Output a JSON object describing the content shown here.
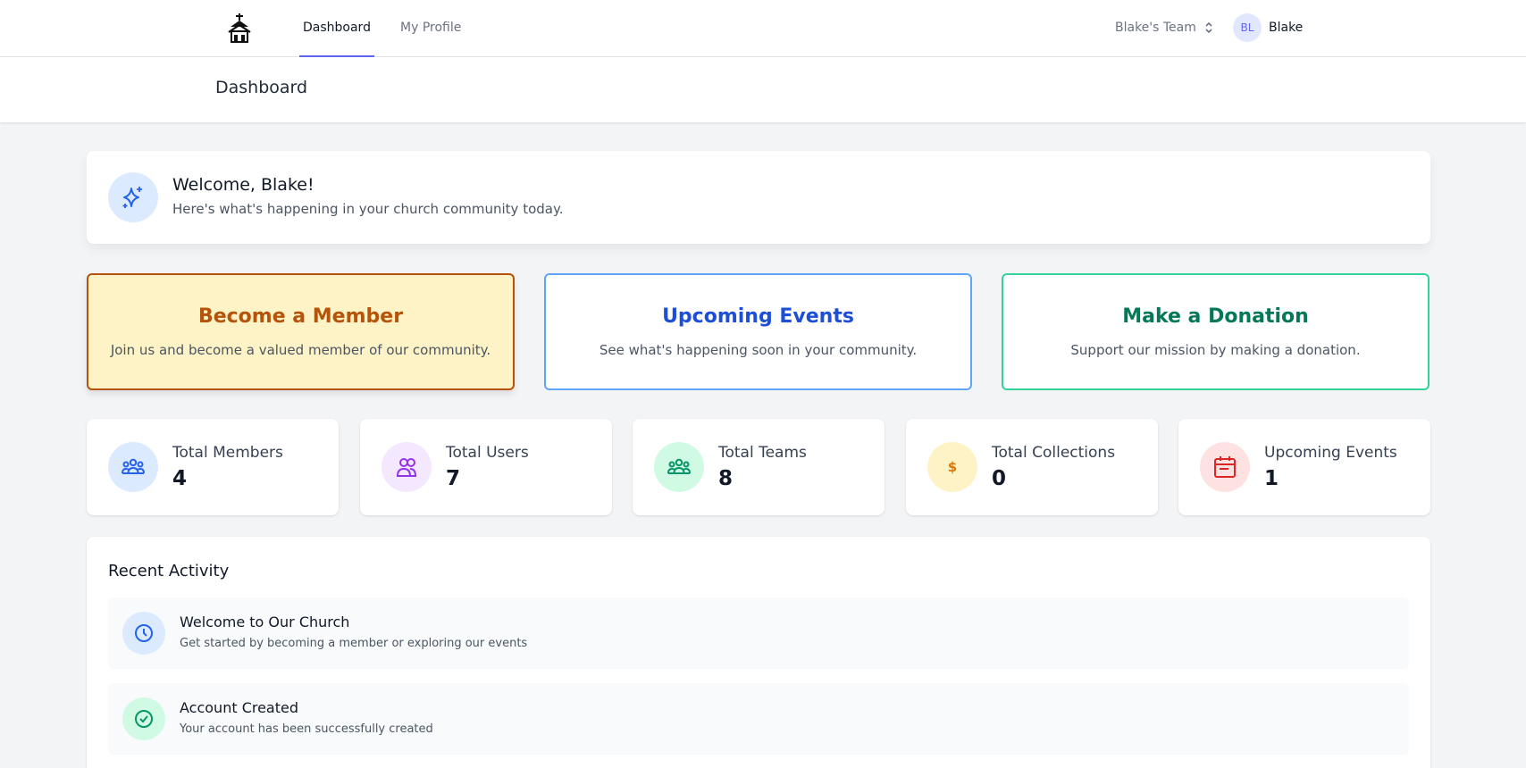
{
  "nav": {
    "links": [
      {
        "label": "Dashboard",
        "active": true
      },
      {
        "label": "My Profile",
        "active": false
      }
    ],
    "team_switcher": "Blake's Team",
    "user": {
      "initials": "BL",
      "name": "Blake"
    }
  },
  "header": {
    "title": "Dashboard"
  },
  "welcome": {
    "title": "Welcome, Blake!",
    "subtitle": "Here's what's happening in your church community today.",
    "icon": "sparkles-icon"
  },
  "actions": [
    {
      "title": "Become a Member",
      "description": "Join us and become a valued member of our community.",
      "color": "#b45309"
    },
    {
      "title": "Upcoming Events",
      "description": "See what's happening soon in your community.",
      "color": "#1d4ed8"
    },
    {
      "title": "Make a Donation",
      "description": "Support our mission by making a donation.",
      "color": "#047857"
    }
  ],
  "stats": [
    {
      "label": "Total Members",
      "value": "4",
      "icon": "members-group-icon",
      "color": "#2563eb",
      "bg": "#dbeafe"
    },
    {
      "label": "Total Users",
      "value": "7",
      "icon": "users-icon",
      "color": "#9333ea",
      "bg": "#f3e8ff"
    },
    {
      "label": "Total Teams",
      "value": "8",
      "icon": "teams-group-icon",
      "color": "#059669",
      "bg": "#d1fae5"
    },
    {
      "label": "Total Collections",
      "value": "0",
      "icon": "dollar-icon",
      "color": "#d97706",
      "bg": "#fef3c7"
    },
    {
      "label": "Upcoming Events",
      "value": "1",
      "icon": "calendar-icon",
      "color": "#dc2626",
      "bg": "#fee2e2"
    }
  ],
  "activity": {
    "title": "Recent Activity",
    "items": [
      {
        "title": "Welcome to Our Church",
        "description": "Get started by becoming a member or exploring our events",
        "icon": "clock-icon"
      },
      {
        "title": "Account Created",
        "description": "Your account has been successfully created",
        "icon": "check-circle-icon"
      }
    ]
  }
}
